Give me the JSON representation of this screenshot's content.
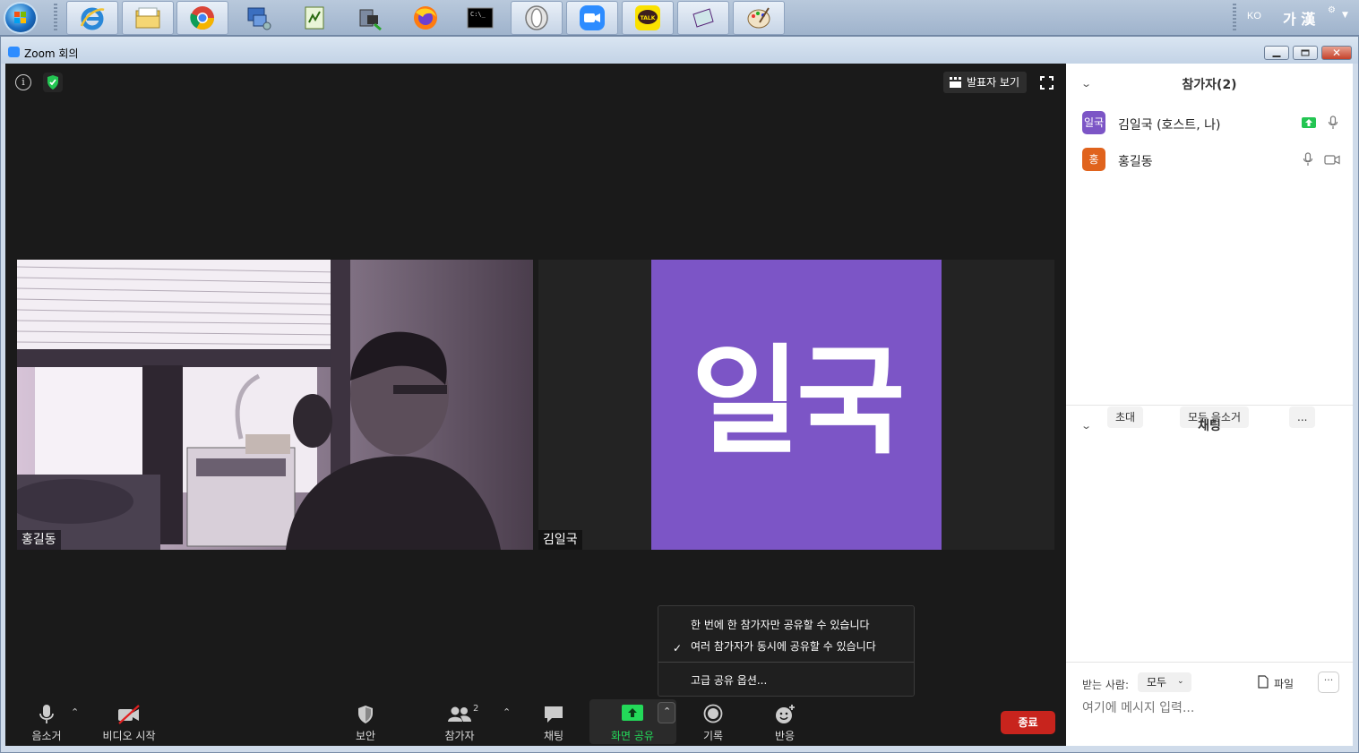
{
  "taskbar": {
    "lang": "KO",
    "ime": "가 漢"
  },
  "window": {
    "title": "Zoom 회의"
  },
  "meeting": {
    "view_button": "발표자 보기",
    "tiles": [
      {
        "name": "홍길동"
      },
      {
        "name": "김일국",
        "avatar_text": "일국",
        "avatar_color": "#7c55c6"
      }
    ],
    "share_menu": {
      "option1": "한 번에 한 참가자만 공유할 수 있습니다",
      "option2": "여러 참가자가 동시에 공유할 수 있습니다",
      "option2_checked": true,
      "advanced": "고급 공유 옵션..."
    },
    "toolbar": {
      "mute": "음소거",
      "video": "비디오 시작",
      "security": "보안",
      "participants": "참가자",
      "participants_count": "2",
      "chat": "채팅",
      "share": "화면 공유",
      "record": "기록",
      "reactions": "반응",
      "end": "종료"
    }
  },
  "panel": {
    "participants_title": "참가자(2)",
    "participants": [
      {
        "initials": "일국",
        "name": "김일국 (호스트, 나)",
        "color": "#7c55c6"
      },
      {
        "initials": "홍",
        "name": "홍길동",
        "color": "#e0631d"
      }
    ],
    "invite": "초대",
    "mute_all": "모두 음소거",
    "more": "...",
    "chat_title": "채팅",
    "to_label": "받는 사람:",
    "to_value": "모두",
    "file": "파일",
    "chat_more": "···",
    "input_placeholder": "여기에 메시지 입력..."
  },
  "colors": {
    "share_green": "#23d959",
    "end_red": "#c8241d",
    "zoom_blue": "#2d8cff"
  }
}
